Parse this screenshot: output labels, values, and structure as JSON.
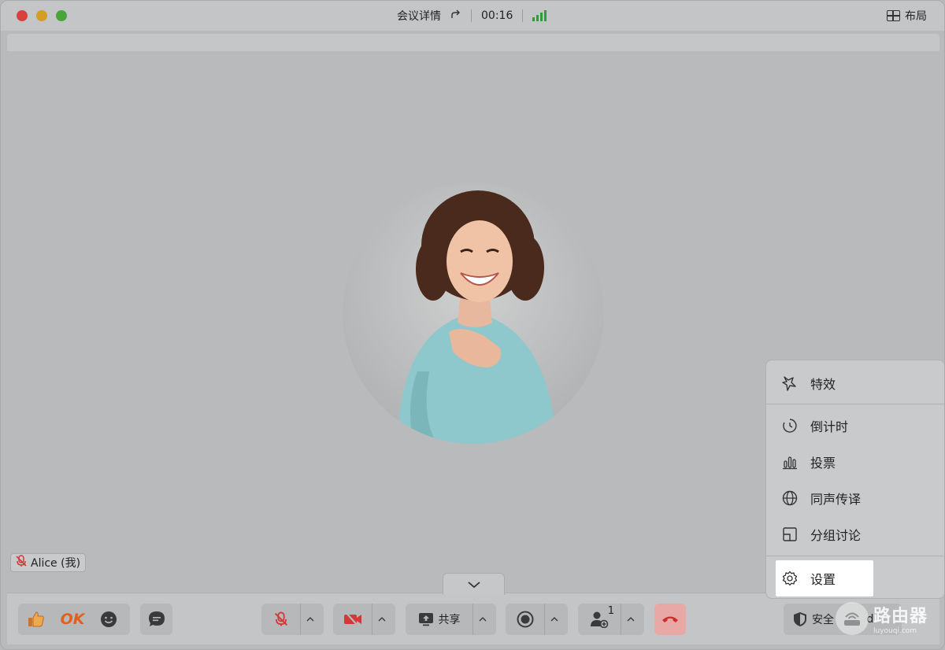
{
  "window": {
    "title": "会议详情",
    "timer": "00:16",
    "layout_label": "布局"
  },
  "participant": {
    "name_tag": "Alice (我)"
  },
  "reactions": {
    "ok_label": "OK"
  },
  "toolbar": {
    "share_label": "共享",
    "security_label": "安全",
    "participants_count": "1",
    "partial_label": "d"
  },
  "more_menu": {
    "items": [
      {
        "label": "特效",
        "icon": "sparkle-icon"
      },
      {
        "label": "倒计时",
        "icon": "timer-icon"
      },
      {
        "label": "投票",
        "icon": "poll-icon"
      },
      {
        "label": "同声传译",
        "icon": "globe-icon"
      },
      {
        "label": "分组讨论",
        "icon": "breakout-icon"
      },
      {
        "label": "设置",
        "icon": "gear-icon"
      }
    ]
  },
  "watermark": {
    "brand": "路由器",
    "site": "luyouqi.com"
  },
  "colors": {
    "close": "#d9413e",
    "minimize": "#d49d24",
    "maximize": "#49a53a",
    "signal": "#2c9e3a",
    "muted": "#d23a3a",
    "hangup_bg": "#e8a9a6",
    "hangup_icon": "#d12c2c"
  }
}
